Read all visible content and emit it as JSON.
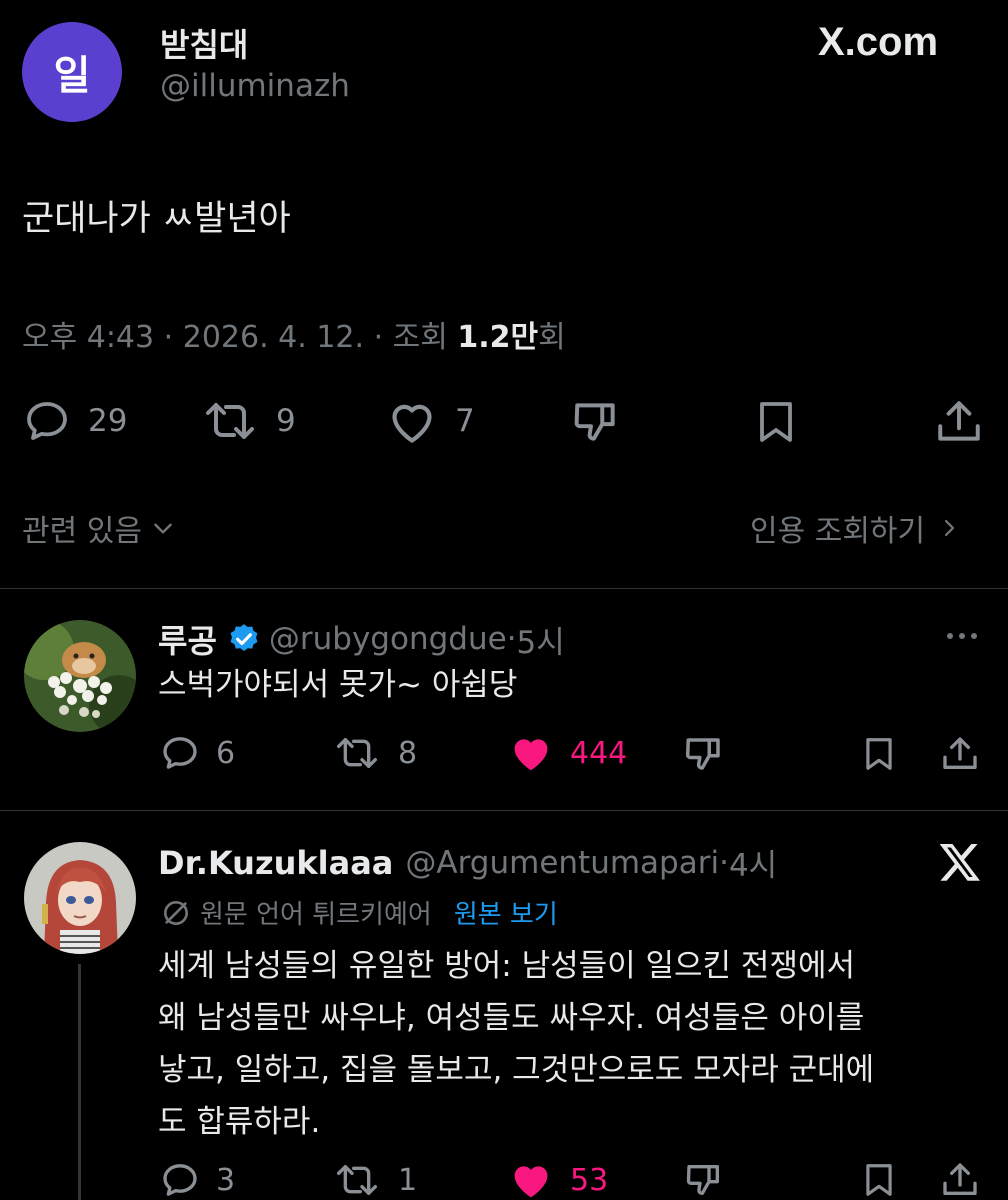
{
  "main_tweet": {
    "avatar_text": "일",
    "avatar_color": "#5b3fcf",
    "display_name": "받침대",
    "handle": "@illuminazh",
    "source_label": "X.com",
    "text": "군대나가 ㅆ발년아",
    "time": "오후 4:43",
    "date": "2026. 4. 12.",
    "views_prefix": "조회",
    "views_count": "1.2만",
    "views_suffix": "회",
    "replies": "29",
    "retweets": "9",
    "likes": "7"
  },
  "related_label": "관련 있음",
  "quotes_label": "인용 조회하기",
  "replies": [
    {
      "display_name": "루공",
      "handle": "@rubygongdue",
      "time": "5시",
      "text": "스벅가야되서 못가~ 아쉽당",
      "replies": "6",
      "retweets": "8",
      "likes": "444",
      "liked": true
    },
    {
      "display_name": "Dr.Kuzuklaaa",
      "handle": "@Argumentumapari",
      "time": "4시",
      "translate_note": "원문 언어 튀르키예어",
      "translate_link": "원본 보기",
      "text_lines": [
        "세계 남성들의 유일한 방어: 남성들이 일으킨 전쟁에서",
        "왜 남성들만 싸우냐, 여성들도 싸우자. 여성들은 아이를",
        "낳고, 일하고, 집을 돌보고, 그것만으로도 모자라 군대에",
        "도 합류하라."
      ],
      "replies": "3",
      "retweets": "1",
      "likes": "53",
      "liked": true
    }
  ],
  "colors": {
    "background": "#000000",
    "text": "#e7e9ea",
    "muted": "#71767b",
    "like": "#f91880",
    "verified": "#1d9bf0",
    "link": "#1d9bf0"
  }
}
